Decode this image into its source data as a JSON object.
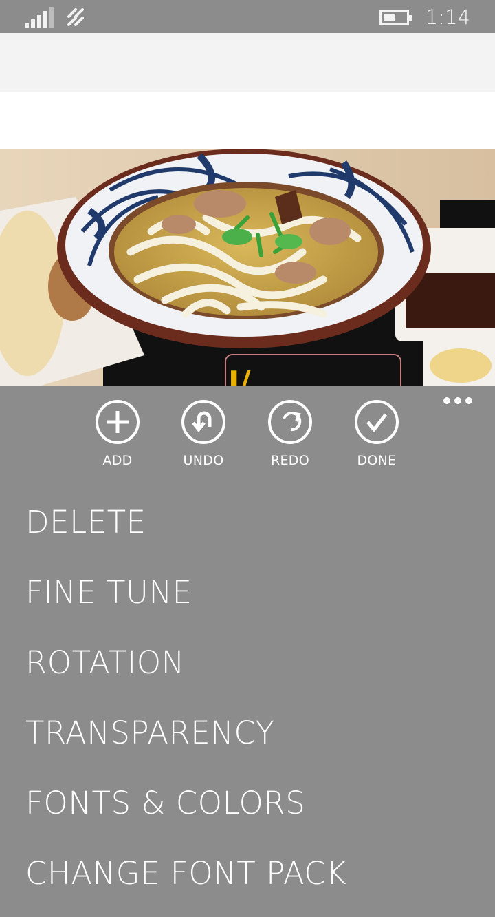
{
  "status_bar": {
    "time": "1:14",
    "icons": [
      "signal-strength-icon",
      "network-activity-icon",
      "battery-icon"
    ]
  },
  "photo": {
    "description_icon": "udon-photo-icon",
    "overlay_text_visible": "J/"
  },
  "app_bar": {
    "buttons": [
      {
        "label": "ADD",
        "icon": "plus-circle-icon"
      },
      {
        "label": "UNDO",
        "icon": "undo-circle-icon"
      },
      {
        "label": "REDO",
        "icon": "redo-circle-icon"
      },
      {
        "label": "DONE",
        "icon": "check-circle-icon"
      }
    ],
    "more_icon": "ellipsis-icon"
  },
  "menu": {
    "items": [
      {
        "label": "DELETE"
      },
      {
        "label": "FINE TUNE"
      },
      {
        "label": "ROTATION"
      },
      {
        "label": "TRANSPARENCY"
      },
      {
        "label": "FONTS & COLORS"
      },
      {
        "label": "CHANGE FONT PACK"
      }
    ]
  },
  "colors": {
    "background": "#8c8c8c",
    "text": "#ffffff",
    "header": "#f3f3f3"
  }
}
